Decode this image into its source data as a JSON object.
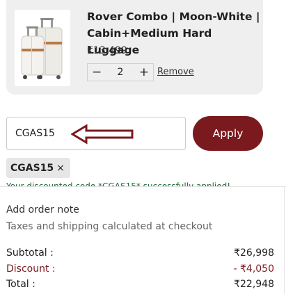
{
  "product": {
    "title": "Rover Combo | Moon-White | Cabin+Medium Hard Luggage",
    "price": "₹13,499",
    "quantity": "2",
    "decrease_symbol": "−",
    "increase_symbol": "+",
    "remove_label": "Remove",
    "image_icon": "luggage-image"
  },
  "coupon": {
    "input_value": "CGAS15",
    "apply_label": "Apply",
    "applied_code": "CGAS15",
    "chip_close": "×",
    "success_message": "Your discounted code *CGAS15* successfully applied!"
  },
  "order": {
    "note_label": "Add order note",
    "tax_note": "Taxes and shipping calculated at checkout"
  },
  "summary": {
    "subtotal_label": "Subtotal :",
    "subtotal_value": "₹26,998",
    "discount_label": "Discount :",
    "discount_value": "- ₹4,050",
    "total_label": "Total :",
    "total_value": "₹22,948"
  },
  "colors": {
    "accent": "#7a1a1f",
    "card_bg": "#efefef",
    "success": "#1e6b37"
  }
}
